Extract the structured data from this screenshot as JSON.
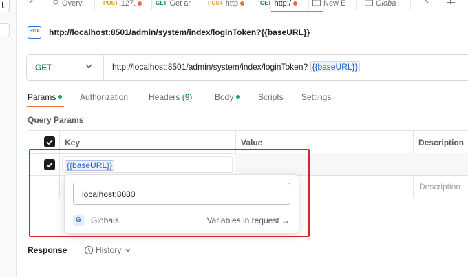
{
  "left_strip": {
    "top_button_label": "t"
  },
  "tabs": [
    {
      "method": "",
      "label": "Overv",
      "dot": false
    },
    {
      "method": "POST",
      "label": "127.",
      "dot": true
    },
    {
      "method": "GET",
      "label": "Get ar",
      "dot": false
    },
    {
      "method": "POST",
      "label": "http",
      "dot": true
    },
    {
      "method": "GET",
      "label": "http:/",
      "dot": true
    },
    {
      "method": "",
      "label": "New E",
      "dot": false
    },
    {
      "method": "",
      "label": "Globa",
      "dot": false
    }
  ],
  "request": {
    "icon_text": "HTTP",
    "title": "http://localhost:8501/admin/system/index/loginToken?{{baseURL}}",
    "method": "GET",
    "url_prefix": "http://localhost:8501/admin/system/index/loginToken?",
    "url_variable": "{{baseURL}}"
  },
  "request_tabs": {
    "params": "Params",
    "authorization": "Authorization",
    "headers": "Headers",
    "headers_count": "(9)",
    "body": "Body",
    "scripts": "Scripts",
    "settings": "Settings"
  },
  "query_params": {
    "section_title": "Query Params",
    "columns": {
      "key": "Key",
      "value": "Value",
      "description": "Description"
    },
    "row_key": "{{baseURL}}",
    "description_placeholder": "Description"
  },
  "variable_popover": {
    "value": "localhost:8080",
    "scope_badge": "G",
    "scope_name": "Globals",
    "link_text": "Variables in request →"
  },
  "response": {
    "label": "Response",
    "history": "History"
  },
  "colors": {
    "accent_orange": "#f26b3a",
    "method_green": "#0b7f43",
    "variable_blue": "#1d5dbf",
    "highlight_red": "#d8232a"
  }
}
